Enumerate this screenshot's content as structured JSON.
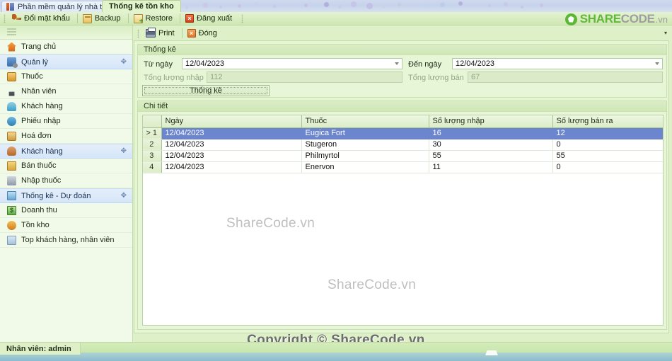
{
  "titlebar": {
    "app_tab": "Phần mềm quản lý nhà thuốc",
    "active_tab": "Thống kê tồn kho"
  },
  "ribbon": {
    "buttons": [
      {
        "label": "Đổi mật khẩu",
        "icon": "key-icon"
      },
      {
        "label": "Backup",
        "icon": "backup-icon"
      },
      {
        "label": "Restore",
        "icon": "restore-icon"
      },
      {
        "label": "Đăng xuất",
        "icon": "logout-icon"
      }
    ],
    "more": "▾"
  },
  "brand": {
    "part1": "SHARE",
    "part2": "CODE",
    "part3": ".vn",
    "accent": "#62b73a",
    "grey": "#9e9e9e"
  },
  "formtoolbar": {
    "print_label": "Print",
    "close_label": "Đóng",
    "overflow": "▾"
  },
  "sidebar": {
    "items": [
      {
        "label": "Trang chủ",
        "icon": "home-icon",
        "group": false,
        "pin": ""
      },
      {
        "label": "Quản lý",
        "icon": "manage-icon",
        "group": true,
        "pin": "✥"
      },
      {
        "label": "Thuốc",
        "icon": "drug-icon",
        "group": false,
        "pin": ""
      },
      {
        "label": "Nhân viên",
        "icon": "staff-icon",
        "group": false,
        "pin": ""
      },
      {
        "label": "Khách hàng",
        "icon": "customer-icon",
        "group": false,
        "pin": ""
      },
      {
        "label": "Phiếu nhập",
        "icon": "receipt-icon",
        "group": false,
        "pin": ""
      },
      {
        "label": "Hoá đơn",
        "icon": "invoice-icon",
        "group": false,
        "pin": ""
      },
      {
        "label": "Khách hàng",
        "icon": "customer2-icon",
        "group": true,
        "pin": "✥"
      },
      {
        "label": "Bán thuốc",
        "icon": "sell-icon",
        "group": false,
        "pin": ""
      },
      {
        "label": "Nhập thuốc",
        "icon": "import-icon",
        "group": false,
        "pin": ""
      },
      {
        "label": "Thống kê - Dự đoán",
        "icon": "stats-icon",
        "group": true,
        "pin": "✥"
      },
      {
        "label": "Doanh thu",
        "icon": "revenue-icon",
        "group": false,
        "pin": ""
      },
      {
        "label": "Tồn kho",
        "icon": "stock-icon",
        "group": false,
        "pin": ""
      },
      {
        "label": "Top khách hàng, nhân viên",
        "icon": "top-icon",
        "group": false,
        "pin": ""
      }
    ]
  },
  "stats_panel": {
    "caption": "Thống kê",
    "from_label": "Từ ngày",
    "from_value": "12/04/2023",
    "to_label": "Đến ngày",
    "to_value": "12/04/2023",
    "total_in_label": "Tổng lượng nhập",
    "total_in_value": "112",
    "total_out_label": "Tổng lượng bán",
    "total_out_value": "67",
    "submit_label": "Thống kê"
  },
  "detail_panel": {
    "caption": "Chi tiết",
    "columns": [
      "",
      "Ngày",
      "Thuốc",
      "Số lượng nhập",
      "Số lượng bán ra"
    ],
    "rows": [
      {
        "idx": "> 1",
        "date": "12/04/2023",
        "drug": "Eugica Fort",
        "qty_in": "16",
        "qty_out": "12",
        "selected": true
      },
      {
        "idx": "2",
        "date": "12/04/2023",
        "drug": "Stugeron",
        "qty_in": "30",
        "qty_out": "0",
        "selected": false
      },
      {
        "idx": "3",
        "date": "12/04/2023",
        "drug": "Philmyrtol",
        "qty_in": "55",
        "qty_out": "55",
        "selected": false
      },
      {
        "idx": "4",
        "date": "12/04/2023",
        "drug": "Enervon",
        "qty_in": "11",
        "qty_out": "0",
        "selected": false
      }
    ]
  },
  "watermarks": {
    "wm1": "ShareCode.vn",
    "wm2": "ShareCode.vn"
  },
  "statusbar": {
    "user": "Nhân viên: admin",
    "copyright": "Copyright © ShareCode.vn"
  }
}
